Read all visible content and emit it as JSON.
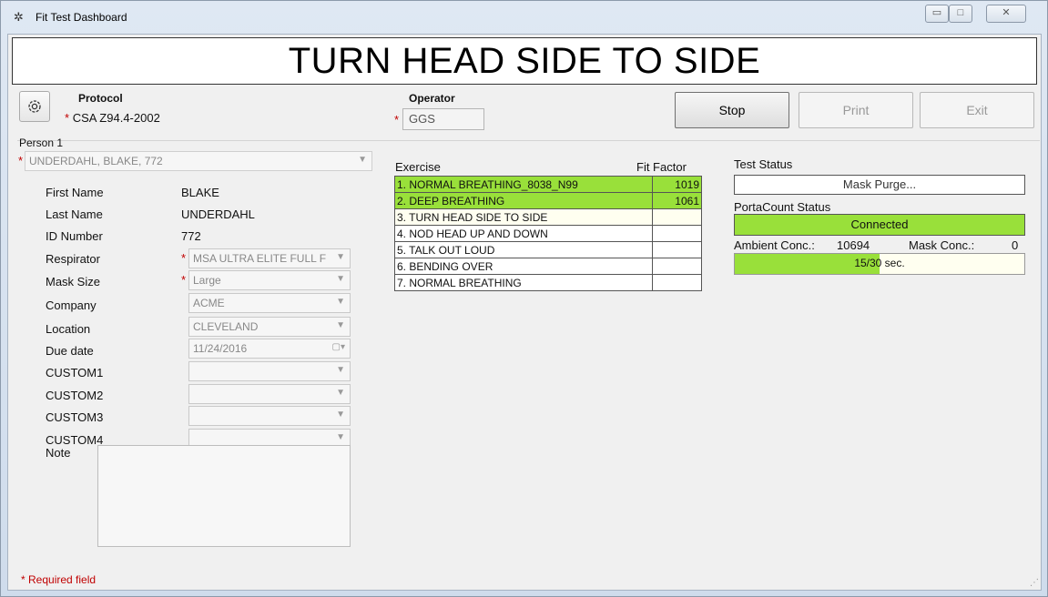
{
  "window": {
    "title": "Fit Test Dashboard",
    "min_glyph": "▭",
    "max_glyph": "□",
    "close_glyph": "✕",
    "app_icon": "tsi-logo-icon"
  },
  "banner": {
    "text": "TURN HEAD SIDE TO SIDE"
  },
  "protocol": {
    "label": "Protocol",
    "required": "*",
    "value": "CSA Z94.4-2002"
  },
  "operator": {
    "label": "Operator",
    "required": "*",
    "value": "GGS"
  },
  "buttons": {
    "stop": "Stop",
    "print": "Print",
    "exit": "Exit"
  },
  "person": {
    "label": "Person 1",
    "required": "*",
    "selected": "UNDERDAHL, BLAKE, 772",
    "first_name": {
      "label": "First Name",
      "value": "BLAKE"
    },
    "last_name": {
      "label": "Last Name",
      "value": "UNDERDAHL"
    },
    "id_number": {
      "label": "ID Number",
      "value": "772"
    },
    "respirator": {
      "label": "Respirator",
      "required": "*",
      "value": "MSA ULTRA ELITE FULL F"
    },
    "mask_size": {
      "label": "Mask Size",
      "required": "*",
      "value": "Large"
    },
    "company": {
      "label": "Company",
      "value": "ACME"
    },
    "location": {
      "label": "Location",
      "value": "CLEVELAND"
    },
    "due_date": {
      "label": "Due date",
      "value": "11/24/2016"
    },
    "custom1": {
      "label": "CUSTOM1",
      "value": ""
    },
    "custom2": {
      "label": "CUSTOM2",
      "value": ""
    },
    "custom3": {
      "label": "CUSTOM3",
      "value": ""
    },
    "custom4": {
      "label": "CUSTOM4",
      "value": ""
    },
    "note": {
      "label": "Note",
      "value": ""
    }
  },
  "required_note": "* Required field",
  "exercises": {
    "header_exercise": "Exercise",
    "header_fit": "Fit Factor",
    "rows": [
      {
        "name": "1. NORMAL BREATHING_8038_N99",
        "fit": "1019",
        "state": "done"
      },
      {
        "name": "2. DEEP BREATHING",
        "fit": "1061",
        "state": "done"
      },
      {
        "name": "3. TURN HEAD SIDE TO SIDE",
        "fit": "",
        "state": "current"
      },
      {
        "name": "4. NOD HEAD UP AND DOWN",
        "fit": "",
        "state": "pending"
      },
      {
        "name": "5. TALK OUT LOUD",
        "fit": "",
        "state": "pending"
      },
      {
        "name": "6. BENDING OVER",
        "fit": "",
        "state": "pending"
      },
      {
        "name": "7. NORMAL BREATHING",
        "fit": "",
        "state": "pending"
      }
    ]
  },
  "status": {
    "test_status_label": "Test Status",
    "test_status_value": "Mask Purge...",
    "portacount_label": "PortaCount Status",
    "portacount_value": "Connected",
    "ambient_label": "Ambient Conc.:",
    "ambient_value": "10694",
    "mask_label": "Mask Conc.:",
    "mask_value": "0",
    "progress_text": "15/30 sec.",
    "progress_fraction": 0.5
  },
  "colors": {
    "done": "#99e03a",
    "required": "#c00000"
  }
}
